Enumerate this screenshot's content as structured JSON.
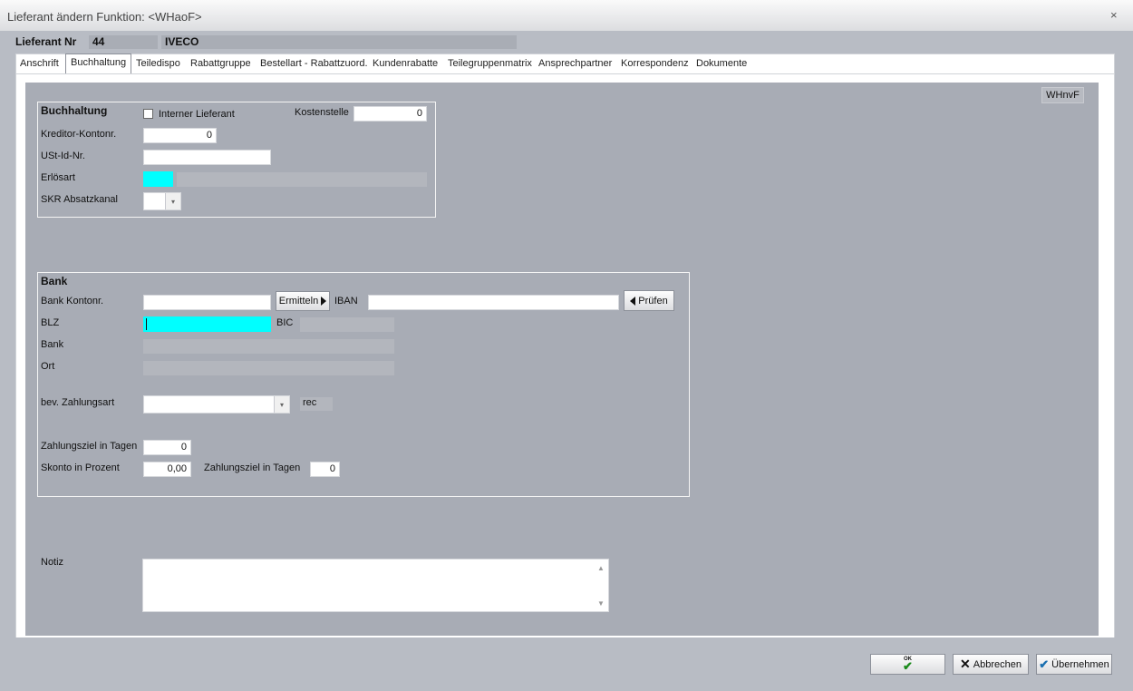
{
  "window": {
    "title": "Lieferant ändern   Funktion: <WHaoF>",
    "close_glyph": "×"
  },
  "header": {
    "nr_label": "Lieferant Nr",
    "nr_value": "44",
    "name_value": "IVECO"
  },
  "tabs": [
    {
      "label": "Anschrift"
    },
    {
      "label": "Buchhaltung"
    },
    {
      "label": "Teiledispo"
    },
    {
      "label": "Rabattgruppe"
    },
    {
      "label": "Bestellart - Rabattzuord."
    },
    {
      "label": "Kundenrabatte"
    },
    {
      "label": "Teilegruppenmatrix"
    },
    {
      "label": "Ansprechpartner"
    },
    {
      "label": "Korrespondenz"
    },
    {
      "label": "Dokumente"
    }
  ],
  "active_tab": "Buchhaltung",
  "code_badge": "WHnvF",
  "buchhaltung": {
    "title": "Buchhaltung",
    "interner_label": "Interner Lieferant",
    "interner_checked": false,
    "kostenstelle_label": "Kostenstelle",
    "kostenstelle_value": "0",
    "kreditor_label": "Kreditor-Kontonr.",
    "kreditor_value": "0",
    "ustid_label": "USt-Id-Nr.",
    "ustid_value": "",
    "erloesart_label": "Erlösart",
    "skr_label": "SKR Absatzkanal",
    "accent_cyan": "#00ffff"
  },
  "bank": {
    "title": "Bank",
    "kontonr_label": "Bank Kontonr.",
    "kontonr_value": "",
    "ermitteln_label": "Ermitteln",
    "iban_label": "IBAN",
    "iban_value": "",
    "pruefen_label": "Prüfen",
    "blz_label": "BLZ",
    "bic_label": "BIC",
    "bank_label": "Bank",
    "ort_label": "Ort",
    "zahlungsart_label": "bev. Zahlungsart",
    "rec_label": "rec",
    "zahlungsziel_label": "Zahlungsziel in Tagen",
    "zahlungsziel_value": "0",
    "skonto_label": "Skonto in Prozent",
    "skonto_value": "0,00",
    "skonto_ziel_label": "Zahlungsziel in Tagen",
    "skonto_ziel_value": "0"
  },
  "notiz": {
    "label": "Notiz",
    "value": ""
  },
  "footer": {
    "ok_label": "OK",
    "abbrechen_label": "Abbrechen",
    "uebernehmen_label": "Übernehmen"
  }
}
